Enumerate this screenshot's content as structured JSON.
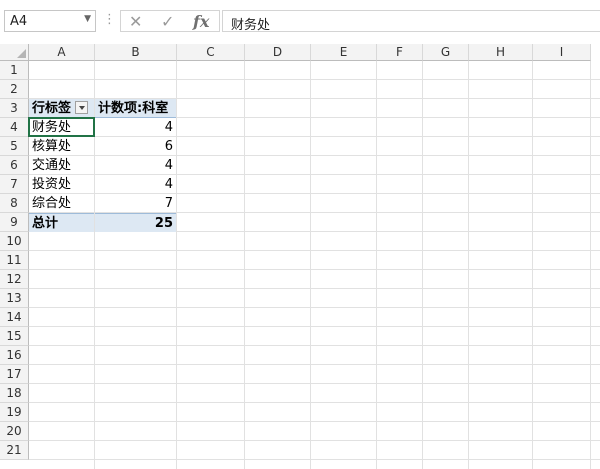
{
  "formula_bar": {
    "name_box": "A4",
    "name_box_dropdown_icon": "chevron-down-icon",
    "cancel_icon": "✕",
    "enter_icon": "✓",
    "fx_label": "fx",
    "content": "财务处"
  },
  "columns": [
    "A",
    "B",
    "C",
    "D",
    "E",
    "F",
    "G",
    "H",
    "I"
  ],
  "rows": [
    "1",
    "2",
    "3",
    "4",
    "5",
    "6",
    "7",
    "8",
    "9",
    "10",
    "11",
    "12",
    "13",
    "14",
    "15",
    "16",
    "17",
    "18",
    "19",
    "20",
    "21"
  ],
  "pivot": {
    "row_label_header": "行标签",
    "value_header": "计数项:科室",
    "items": [
      {
        "label": "财务处",
        "count": "4"
      },
      {
        "label": "核算处",
        "count": "6"
      },
      {
        "label": "交通处",
        "count": "4"
      },
      {
        "label": "投资处",
        "count": "4"
      },
      {
        "label": "综合处",
        "count": "7"
      }
    ],
    "total_label": "总计",
    "total_value": "25"
  },
  "selection": "A4"
}
